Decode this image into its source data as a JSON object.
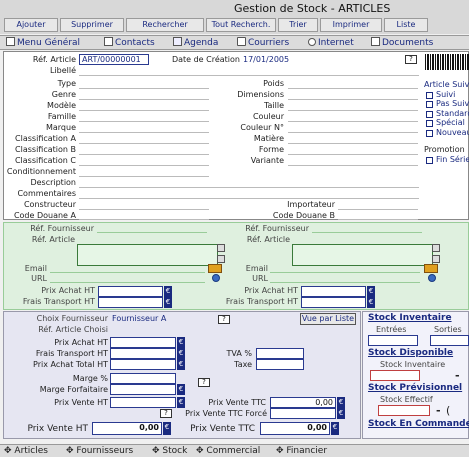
{
  "window": {
    "title": "Gestion de Stock - ARTICLES"
  },
  "toolbar": {
    "buttons": [
      "Ajouter",
      "Supprimer",
      "Rechercher",
      "Tout Recherch.",
      "Trier",
      "Imprimer",
      "Liste"
    ]
  },
  "menu": {
    "items": [
      "Menu Général",
      "Contacts",
      "Agenda",
      "Courriers",
      "Internet",
      "Documents"
    ]
  },
  "article": {
    "ref_label": "Réf. Article",
    "ref_value": "ART/00000001",
    "date_label": "Date de Création",
    "date_value": "17/01/2005",
    "help": "?",
    "left_labels": [
      "Libellé",
      "Type",
      "Genre",
      "Modèle",
      "Famille",
      "Marque",
      "Classification A",
      "Classification B",
      "Classification C",
      "Conditionnement",
      "Description",
      "Commentaires",
      "Constructeur",
      "Code Douane A"
    ],
    "right_labels": [
      "Poids",
      "Dimensions",
      "Taille",
      "Couleur",
      "Couleur N°",
      "Matière",
      "Forme",
      "Variante"
    ],
    "importer_label": "Importateur",
    "code_douane_b": "Code Douane B",
    "follow_title": "Article Suivi",
    "follow_options": [
      "Suivi",
      "Pas Suivi",
      "Standard",
      "Spécial",
      "Nouveau"
    ],
    "promotion_title": "Promotion",
    "promotion_options": [
      "Fin Série"
    ]
  },
  "suppliers": {
    "fournisseur_label": "Réf. Fournisseur",
    "article_label": "Réf. Article",
    "email_label": "Email",
    "url_label": "URL",
    "prix_achat_label": "Prix Achat HT",
    "frais_transport_label": "Frais Transport HT",
    "euro": "€"
  },
  "pricing": {
    "choix_label": "Choix Fournisseur",
    "choix_value": "Fournisseur A",
    "ref_choisi_label": "Réf. Article Choisi",
    "vue_par_liste": "Vue par Liste",
    "labels": [
      "Prix Achat HT",
      "Frais Transport HT",
      "Prix Achat Total HT",
      "Marge %",
      "Marge Forfaitaire",
      "Prix Vente HT"
    ],
    "tva_label": "TVA %",
    "taxe_label": "Taxe",
    "prix_vente_ttc_label": "Prix Vente TTC",
    "prix_vente_ttc_value": "0,00",
    "prix_vente_ttc_force_label": "Prix Vente TTC Forcé",
    "bottom_ht_label": "Prix Vente HT",
    "bottom_ht_value": "0,00",
    "bottom_ttc_label": "Prix Vente TTC",
    "bottom_ttc_value": "0,00",
    "euro": "€",
    "help": "?"
  },
  "stock": {
    "inventaire_title": "Stock Inventaire",
    "entrees_label": "Entrées",
    "sorties_label": "Sorties",
    "disponible_title": "Stock Disponible",
    "stock_inventaire_label": "Stock Inventaire",
    "previsionnel_title": "Stock Prévisionnel",
    "stock_effectif_label": "Stock Effectif",
    "en_commande_title": "Stock En Commande",
    "minus": "-",
    "paren": "("
  },
  "bottom_nav": {
    "items": [
      "Articles",
      "Fournisseurs",
      "Stock",
      "Commercial",
      "Financier"
    ]
  },
  "colors": {
    "accent": "#1a2a80",
    "supplier_bg": "#dff0df",
    "price_bg": "#e6e6f2"
  }
}
